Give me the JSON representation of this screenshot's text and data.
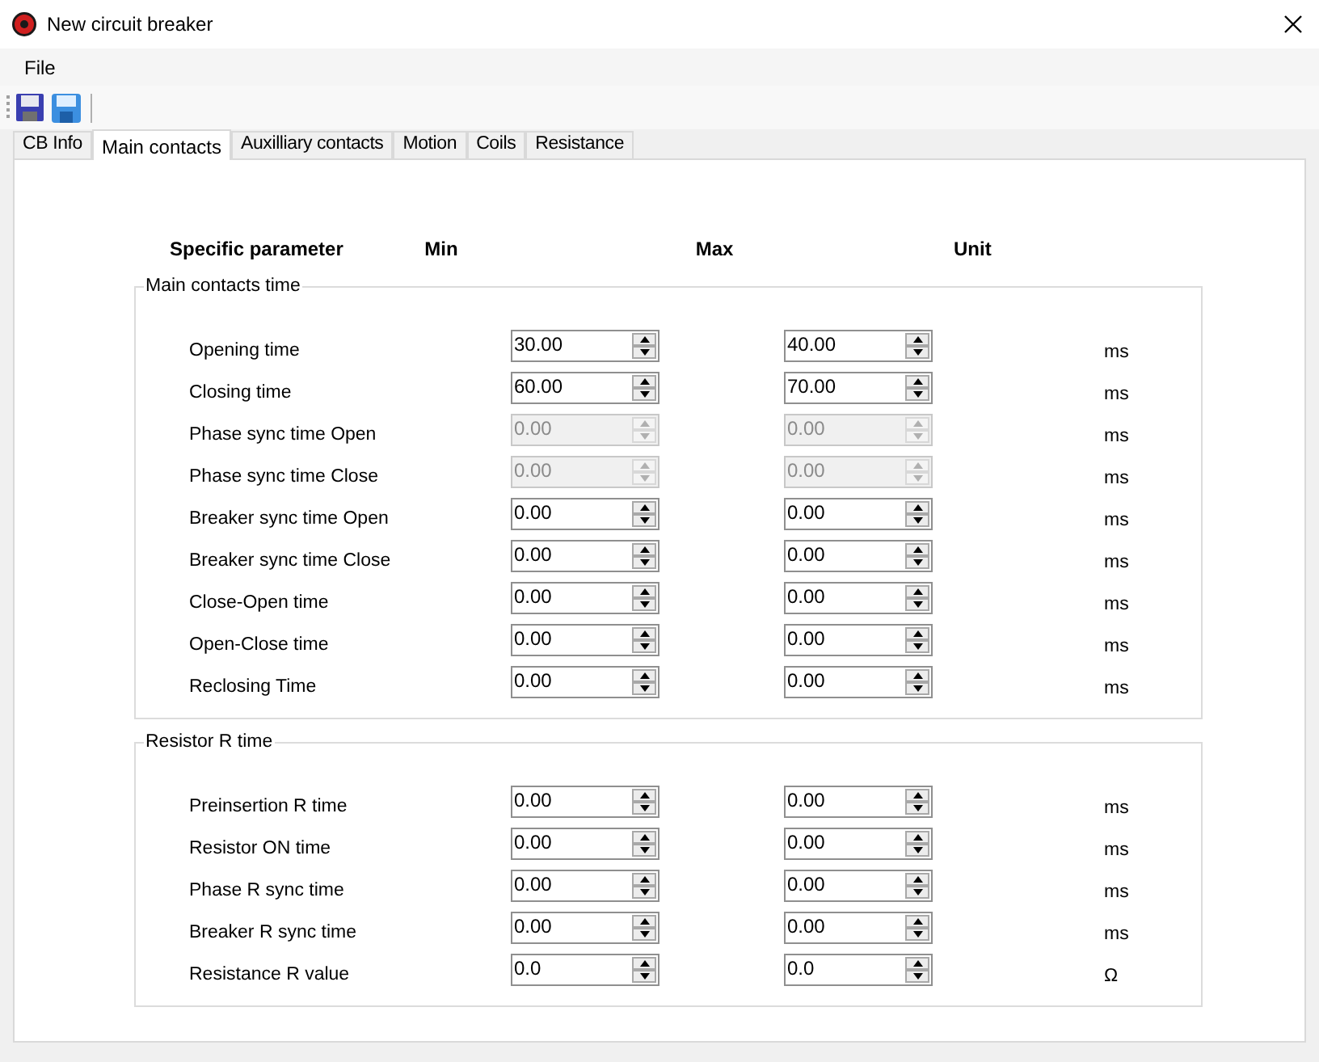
{
  "window": {
    "title": "New circuit breaker"
  },
  "menu": [
    "File"
  ],
  "tabs": [
    {
      "label": "CB Info",
      "selected": false
    },
    {
      "label": "Main contacts",
      "selected": true
    },
    {
      "label": "Auxilliary contacts",
      "selected": false
    },
    {
      "label": "Motion",
      "selected": false
    },
    {
      "label": "Coils",
      "selected": false
    },
    {
      "label": "Resistance",
      "selected": false
    }
  ],
  "columns": [
    "Specific parameter",
    "Min",
    "Max",
    "Unit"
  ],
  "groups": [
    {
      "title": "Main contacts time",
      "rows": [
        {
          "label": "Opening time",
          "min": "30.00",
          "max": "40.00",
          "unit": "ms",
          "disabled": false
        },
        {
          "label": "Closing time",
          "min": "60.00",
          "max": "70.00",
          "unit": "ms",
          "disabled": false
        },
        {
          "label": "Phase sync time Open",
          "min": "0.00",
          "max": "0.00",
          "unit": "ms",
          "disabled": true
        },
        {
          "label": "Phase sync time Close",
          "min": "0.00",
          "max": "0.00",
          "unit": "ms",
          "disabled": true
        },
        {
          "label": "Breaker sync time Open",
          "min": "0.00",
          "max": "0.00",
          "unit": "ms",
          "disabled": false
        },
        {
          "label": "Breaker sync time Close",
          "min": "0.00",
          "max": "0.00",
          "unit": "ms",
          "disabled": false
        },
        {
          "label": "Close-Open time",
          "min": "0.00",
          "max": "0.00",
          "unit": "ms",
          "disabled": false
        },
        {
          "label": "Open-Close time",
          "min": "0.00",
          "max": "0.00",
          "unit": "ms",
          "disabled": false
        },
        {
          "label": "Reclosing Time",
          "min": "0.00",
          "max": "0.00",
          "unit": "ms",
          "disabled": false
        }
      ]
    },
    {
      "title": "Resistor R time",
      "rows": [
        {
          "label": "Preinsertion R time",
          "min": "0.00",
          "max": "0.00",
          "unit": "ms",
          "disabled": false
        },
        {
          "label": "Resistor ON time",
          "min": "0.00",
          "max": "0.00",
          "unit": "ms",
          "disabled": false
        },
        {
          "label": "Phase R sync time",
          "min": "0.00",
          "max": "0.00",
          "unit": "ms",
          "disabled": false
        },
        {
          "label": "Breaker R sync time",
          "min": "0.00",
          "max": "0.00",
          "unit": "ms",
          "disabled": false
        },
        {
          "label": "Resistance R value",
          "min": "0.0",
          "max": "0.0",
          "unit": "Ω",
          "disabled": false
        }
      ]
    }
  ]
}
